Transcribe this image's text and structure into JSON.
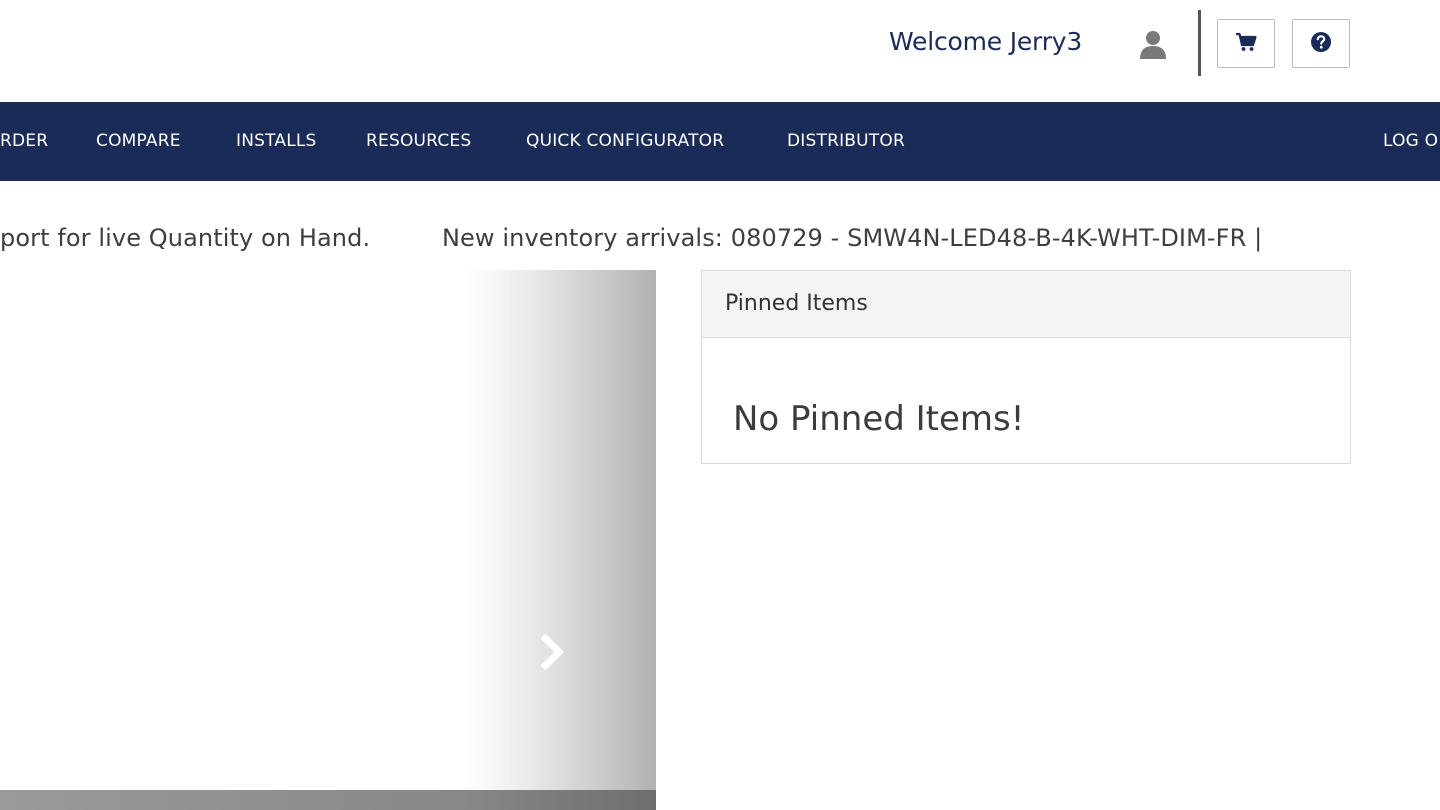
{
  "header": {
    "welcome": "Welcome Jerry3",
    "user_icon": "user-icon",
    "cart_icon": "cart-icon",
    "help_icon": "question-circle-icon"
  },
  "nav": {
    "items": [
      "RDER",
      "COMPARE",
      "INSTALLS",
      "RESOURCES",
      "QUICK CONFIGURATOR",
      "DISTRIBUTOR"
    ],
    "logout": "LOG O"
  },
  "ticker": {
    "segment1": "port for live Quantity on Hand.",
    "segment2": "New inventory arrivals: 080729 - SMW4N-LED48-B-4K-WHT-DIM-FR |"
  },
  "carousel": {
    "next_icon": "chevron-right-icon"
  },
  "pinned": {
    "title": "Pinned Items",
    "empty_message": "No Pinned Items!"
  },
  "colors": {
    "nav_bg": "#1a2b57",
    "welcome_text": "#1a2b57"
  }
}
